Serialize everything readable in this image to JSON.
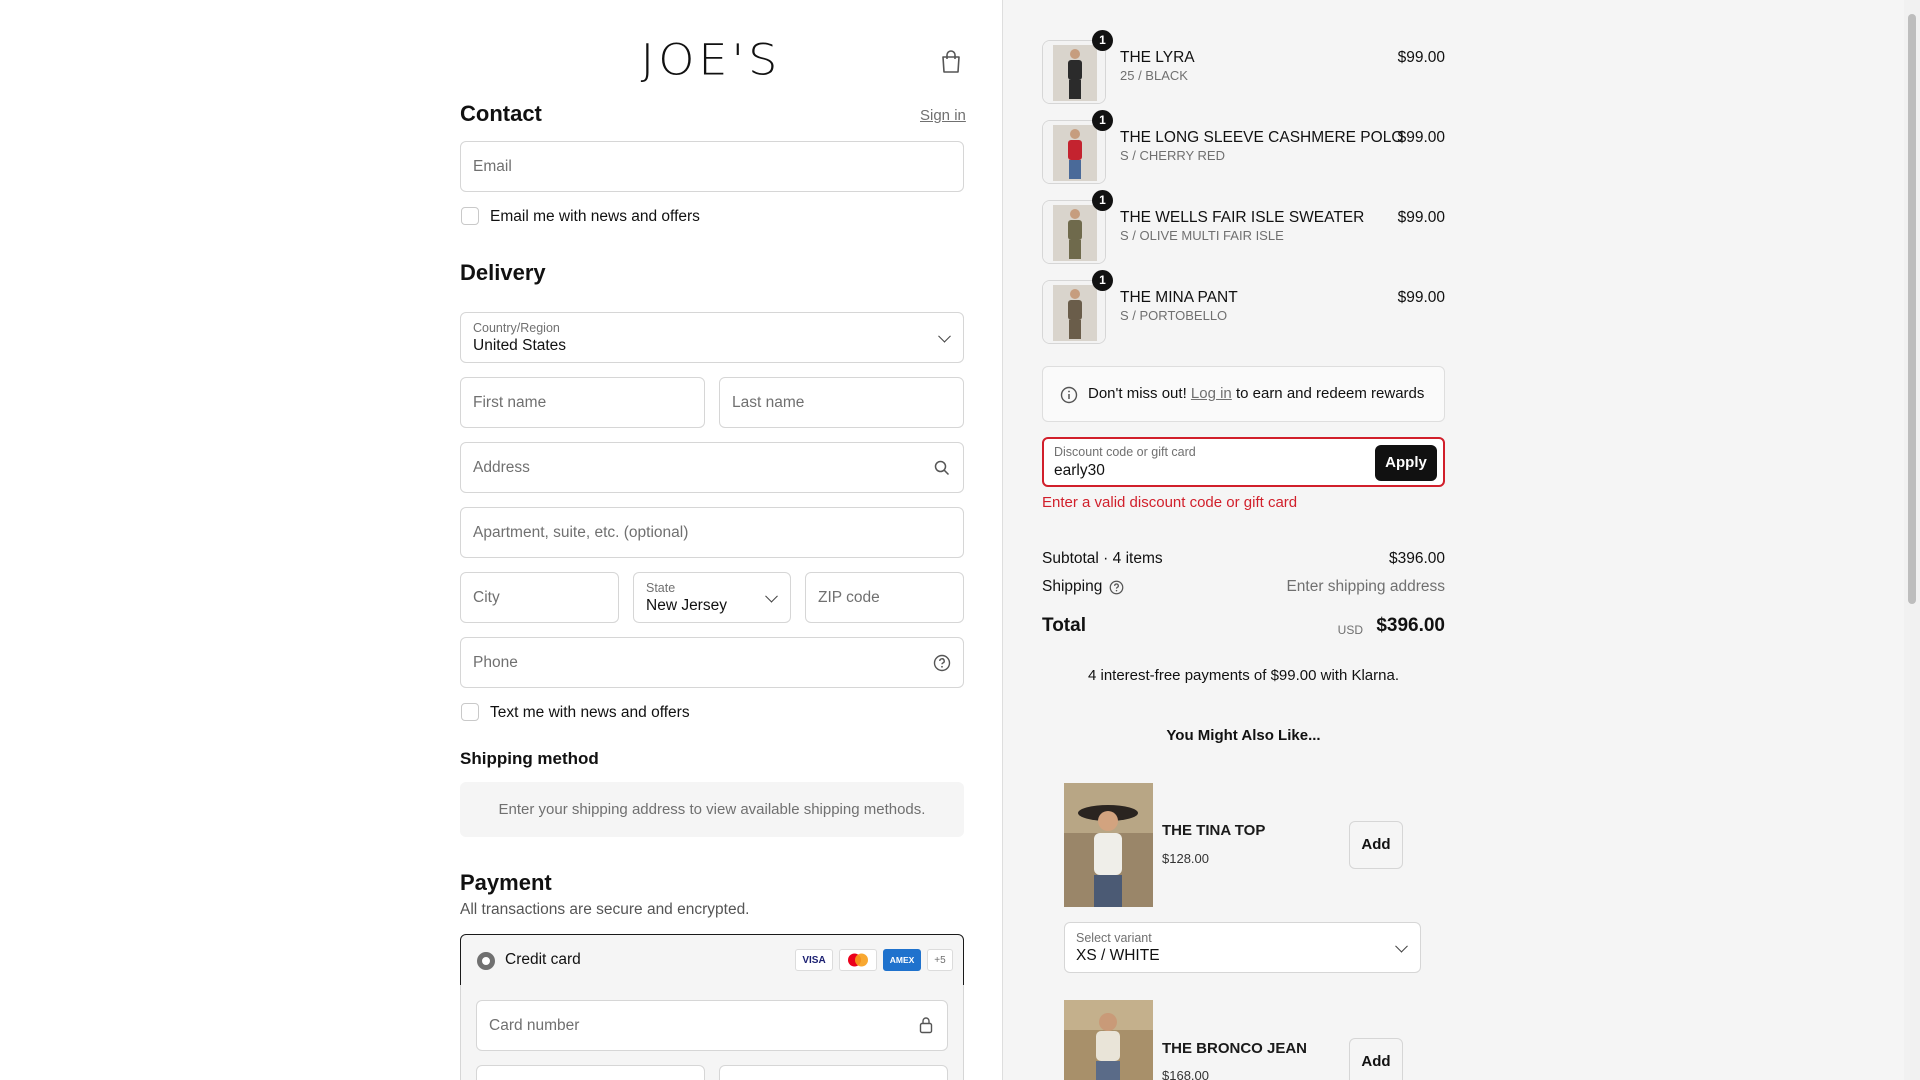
{
  "brand": {
    "logo_text": "JOE'S"
  },
  "contact": {
    "heading": "Contact",
    "sign_in": "Sign in",
    "email_placeholder": "Email",
    "email_optin": "Email me with news and offers"
  },
  "delivery": {
    "heading": "Delivery",
    "country_label": "Country/Region",
    "country_value": "United States",
    "first_name_placeholder": "First name",
    "last_name_placeholder": "Last name",
    "address_placeholder": "Address",
    "apartment_placeholder": "Apartment, suite, etc. (optional)",
    "city_placeholder": "City",
    "state_label": "State",
    "state_value": "New Jersey",
    "zip_placeholder": "ZIP code",
    "phone_placeholder": "Phone",
    "text_optin": "Text me with news and offers"
  },
  "shipping_method": {
    "heading": "Shipping method",
    "note": "Enter your shipping address to view available shipping methods."
  },
  "payment": {
    "heading": "Payment",
    "subtext": "All transactions are secure and encrypted.",
    "credit_card_label": "Credit card",
    "card_logos": [
      "VISA",
      "MC",
      "AMEX",
      "+5"
    ],
    "card_number_placeholder": "Card number"
  },
  "cart": {
    "items": [
      {
        "qty": "1",
        "name": "THE LYRA",
        "variant": "25 / BLACK",
        "price": "$99.00",
        "color": "#2b2b2b"
      },
      {
        "qty": "1",
        "name": "THE LONG SLEEVE CASHMERE POLO",
        "variant": "S / CHERRY RED",
        "price": "$99.00",
        "color": "#c4232f"
      },
      {
        "qty": "1",
        "name": "THE WELLS FAIR ISLE SWEATER",
        "variant": "S / OLIVE MULTI FAIR ISLE",
        "price": "$99.00",
        "color": "#6f6a4c"
      },
      {
        "qty": "1",
        "name": "THE MINA PANT",
        "variant": "S / PORTOBELLO",
        "price": "$99.00",
        "color": "#6a5d4a"
      }
    ],
    "rewards_pre": "Don't miss out!",
    "rewards_link": "Log in",
    "rewards_post": "to earn and redeem rewards",
    "discount_label": "Discount code or gift card",
    "discount_value": "early30",
    "apply_label": "Apply",
    "discount_error": "Enter a valid discount code or gift card",
    "subtotal_label": "Subtotal · 4 items",
    "subtotal_value": "$396.00",
    "shipping_label": "Shipping",
    "shipping_value": "Enter shipping address",
    "total_label": "Total",
    "total_currency": "USD",
    "total_value": "$396.00",
    "klarna": "4 interest-free payments of $99.00 with Klarna."
  },
  "upsell": {
    "heading": "You Might Also Like...",
    "products": [
      {
        "name": "THE TINA TOP",
        "price": "$128.00",
        "add": "Add",
        "variant_label": "Select variant",
        "variant_value": "XS / WHITE"
      },
      {
        "name": "THE BRONCO JEAN",
        "price": "$168.00",
        "add": "Add"
      }
    ]
  },
  "colors": {
    "accent": "#111111",
    "error": "#d11f2b",
    "panel": "#f5f5f5"
  }
}
